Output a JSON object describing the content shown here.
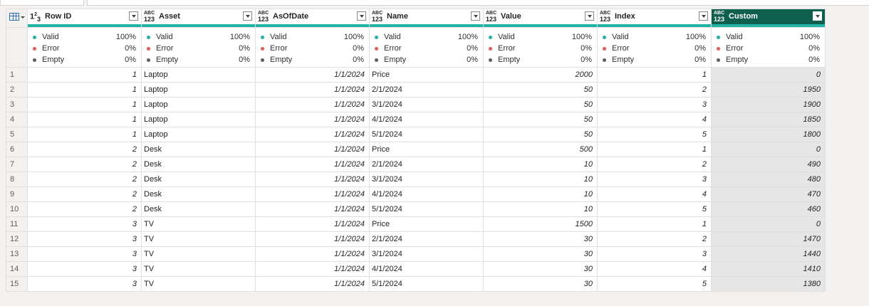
{
  "columns": [
    {
      "name": "Row ID",
      "type": "int"
    },
    {
      "name": "Asset",
      "type": "any"
    },
    {
      "name": "AsOfDate",
      "type": "any"
    },
    {
      "name": "Name",
      "type": "any"
    },
    {
      "name": "Value",
      "type": "any"
    },
    {
      "name": "Index",
      "type": "any"
    },
    {
      "name": "Custom",
      "type": "any",
      "selected": true
    }
  ],
  "type_icons": {
    "int_prefix": "1",
    "int_sup": "2",
    "int_suffix": "3",
    "abc": "ABC",
    "n123": "123"
  },
  "quality": {
    "valid_label": "Valid",
    "error_label": "Error",
    "empty_label": "Empty",
    "valid_pct": "100%",
    "error_pct": "0%",
    "empty_pct": "0%"
  },
  "rows": [
    [
      "1",
      "1",
      "Laptop",
      "1/1/2024",
      "Price",
      "2000",
      "1",
      "0"
    ],
    [
      "2",
      "1",
      "Laptop",
      "1/1/2024",
      "2/1/2024",
      "50",
      "2",
      "1950"
    ],
    [
      "3",
      "1",
      "Laptop",
      "1/1/2024",
      "3/1/2024",
      "50",
      "3",
      "1900"
    ],
    [
      "4",
      "1",
      "Laptop",
      "1/1/2024",
      "4/1/2024",
      "50",
      "4",
      "1850"
    ],
    [
      "5",
      "1",
      "Laptop",
      "1/1/2024",
      "5/1/2024",
      "50",
      "5",
      "1800"
    ],
    [
      "6",
      "2",
      "Desk",
      "1/1/2024",
      "Price",
      "500",
      "1",
      "0"
    ],
    [
      "7",
      "2",
      "Desk",
      "1/1/2024",
      "2/1/2024",
      "10",
      "2",
      "490"
    ],
    [
      "8",
      "2",
      "Desk",
      "1/1/2024",
      "3/1/2024",
      "10",
      "3",
      "480"
    ],
    [
      "9",
      "2",
      "Desk",
      "1/1/2024",
      "4/1/2024",
      "10",
      "4",
      "470"
    ],
    [
      "10",
      "2",
      "Desk",
      "1/1/2024",
      "5/1/2024",
      "10",
      "5",
      "460"
    ],
    [
      "11",
      "3",
      "TV",
      "1/1/2024",
      "Price",
      "1500",
      "1",
      "0"
    ],
    [
      "12",
      "3",
      "TV",
      "1/1/2024",
      "2/1/2024",
      "30",
      "2",
      "1470"
    ],
    [
      "13",
      "3",
      "TV",
      "1/1/2024",
      "3/1/2024",
      "30",
      "3",
      "1440"
    ],
    [
      "14",
      "3",
      "TV",
      "1/1/2024",
      "4/1/2024",
      "30",
      "4",
      "1410"
    ],
    [
      "15",
      "3",
      "TV",
      "1/1/2024",
      "5/1/2024",
      "30",
      "5",
      "1380"
    ]
  ],
  "colors": {
    "accent": "#0f5f4f",
    "valid": "#1fb4a3",
    "error": "#e35c5c",
    "empty": "#605e5c"
  }
}
